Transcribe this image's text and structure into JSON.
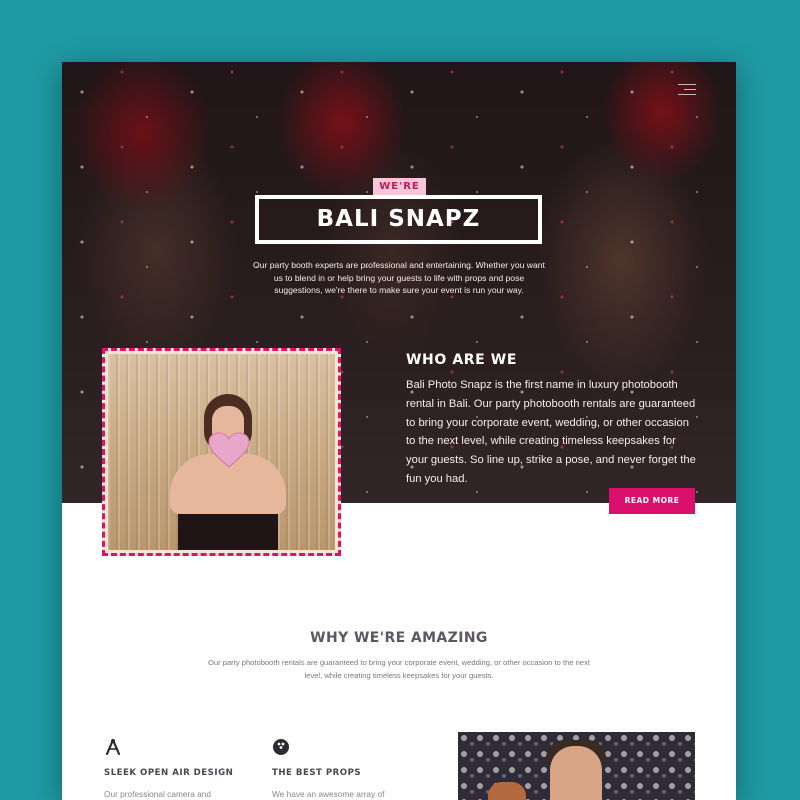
{
  "colors": {
    "background": "#1e9aa4",
    "accent": "#db0f6c",
    "accent_light": "#f6c7d6"
  },
  "nav": {
    "menu_icon": "hamburger-icon"
  },
  "hero": {
    "tag": "WE'RE",
    "title": "BALI SNAPZ",
    "intro": "Our party booth experts are professional and entertaining. Whether you want us to blend in or help bring your guests to life with props and pose suggestions, we're there to make sure your event is run your way."
  },
  "about": {
    "title": "WHO ARE WE",
    "text": "Bali Photo Snapz is the first name in luxury photobooth rental in Bali. Our party photobooth rentals are guaranteed to bring your corporate event, wedding, or other occasion to the next level, while creating timeless keepsakes for your guests. So line up, strike a pose, and never forget the fun you had.",
    "button": "READ MORE"
  },
  "why": {
    "title_highlight": "WHY",
    "title_rest": " WE'RE AMAZING",
    "subtitle": "Our party photobooth rentals are guaranteed to bring your corporate event, wedding, or other occasion to the next level, while creating timeless keepsakes for your guests."
  },
  "features": [
    {
      "icon": "compass-icon",
      "title": "SLEEK OPEN AIR DESIGN",
      "text": "Our professional camera and"
    },
    {
      "icon": "bowling-ball-icon",
      "title": "THE BEST PROPS",
      "text": "We have an awesome array of"
    }
  ]
}
